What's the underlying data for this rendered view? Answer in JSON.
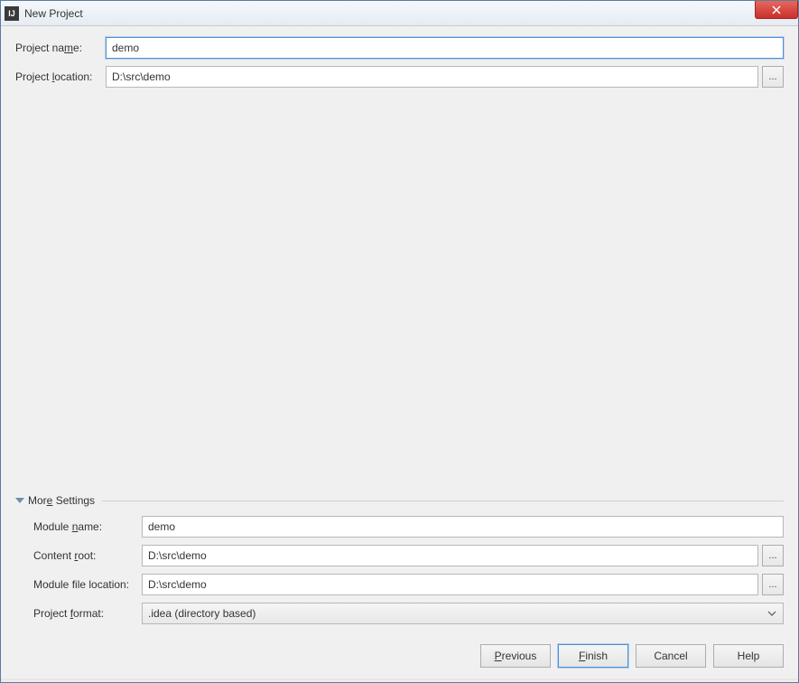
{
  "window": {
    "title": "New Project"
  },
  "fields": {
    "projectName": {
      "label": "Project name:",
      "value": "demo",
      "mnemonic": "m"
    },
    "projectLocation": {
      "label": "Project location:",
      "value": "D:\\src\\demo",
      "mnemonic": "l",
      "browse": "..."
    }
  },
  "moreSettings": {
    "label": "More Settings",
    "mnemonic": "e",
    "moduleName": {
      "label": "Module name:",
      "value": "demo",
      "mnemonic": "n"
    },
    "contentRoot": {
      "label": "Content root:",
      "value": "D:\\src\\demo",
      "mnemonic": "r",
      "browse": "..."
    },
    "moduleFileLocation": {
      "label": "Module file location:",
      "value": "D:\\src\\demo",
      "browse": "..."
    },
    "projectFormat": {
      "label": "Project format:",
      "value": ".idea (directory based)",
      "mnemonic": "f"
    }
  },
  "buttons": {
    "previous": "Previous",
    "finish": "Finish",
    "cancel": "Cancel",
    "help": "Help"
  }
}
